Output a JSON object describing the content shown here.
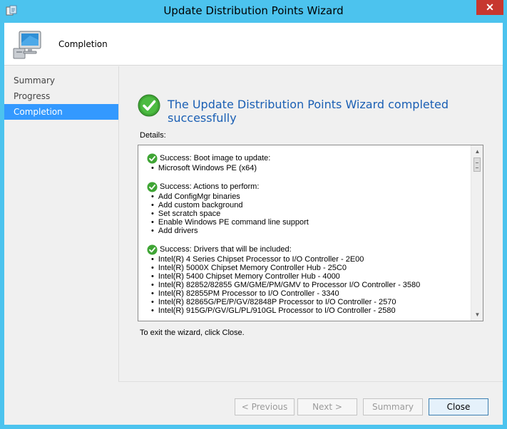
{
  "window": {
    "title": "Update Distribution Points Wizard",
    "close_glyph": "✕"
  },
  "header": {
    "title": "Completion",
    "icon": "computer-icon"
  },
  "nav": {
    "items": [
      {
        "label": "Summary",
        "active": false
      },
      {
        "label": "Progress",
        "active": false
      },
      {
        "label": "Completion",
        "active": true
      }
    ]
  },
  "main": {
    "success_title": "The Update Distribution Points Wizard completed successfully",
    "details_label": "Details:",
    "exit_text": "To exit the wizard, click Close."
  },
  "details": {
    "sections": [
      {
        "heading": "Success: Boot image to update:",
        "items": [
          "Microsoft Windows PE (x64)"
        ]
      },
      {
        "heading": "Success: Actions to perform:",
        "items": [
          "Add ConfigMgr binaries",
          "Add custom background",
          "Set scratch space",
          "Enable Windows PE command line support",
          "Add drivers"
        ]
      },
      {
        "heading": "Success: Drivers that will be included:",
        "items": [
          "Intel(R) 4 Series Chipset Processor to I/O Controller - 2E00",
          "Intel(R) 5000X Chipset Memory Controller Hub - 25C0",
          "Intel(R) 5400 Chipset Memory Controller Hub - 4000",
          "Intel(R) 82852/82855 GM/GME/PM/GMV to Processor I/O Controller - 3580",
          "Intel(R) 82855PM Processor to I/O Controller - 3340",
          "Intel(R) 82865G/PE/P/GV/82848P Processor to I/O Controller - 2570",
          "Intel(R) 915G/P/GV/GL/PL/910GL Processor to I/O Controller - 2580"
        ]
      }
    ]
  },
  "footer": {
    "previous_label": "< Previous",
    "next_label": "Next >",
    "summary_label": "Summary",
    "close_label": "Close"
  },
  "colors": {
    "title_bar": "#4cc3ee",
    "accent": "#3399ff",
    "success_text": "#1a5fb4",
    "success_green": "#3fa535",
    "close_button": "#c7372f"
  }
}
